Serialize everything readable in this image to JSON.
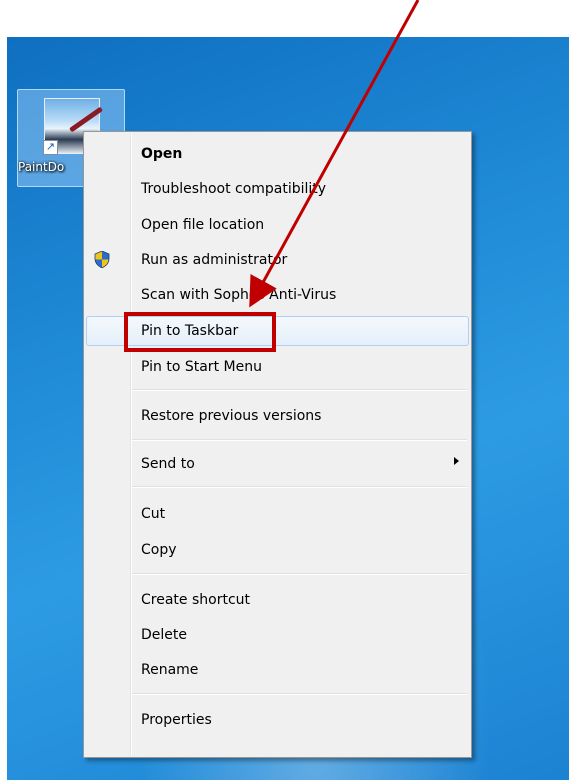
{
  "desktop_icon": {
    "label": "PaintDo",
    "icon": "paint-shortcut-icon"
  },
  "context_menu": {
    "items": [
      {
        "label": "Open",
        "bold": true
      },
      {
        "label": "Troubleshoot compatibility"
      },
      {
        "label": "Open file location"
      },
      {
        "label": "Run as administrator",
        "icon": "uac-shield-icon"
      },
      {
        "label": "Scan with Sophos Anti-Virus"
      },
      {
        "label": "Pin to Taskbar",
        "highlighted": true
      },
      {
        "label": "Pin to Start Menu"
      },
      {
        "label": "Restore previous versions"
      },
      {
        "label": "Send to",
        "submenu": true
      },
      {
        "label": "Cut"
      },
      {
        "label": "Copy"
      },
      {
        "label": "Create shortcut"
      },
      {
        "label": "Delete"
      },
      {
        "label": "Rename"
      },
      {
        "label": "Properties"
      }
    ]
  },
  "annotation": {
    "color": "#c00000",
    "target": "Pin to Taskbar"
  }
}
